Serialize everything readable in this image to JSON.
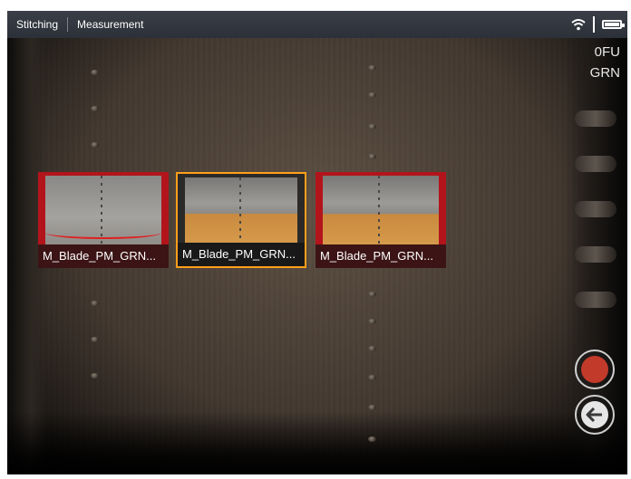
{
  "topbar": {
    "tabs": [
      "Stitching",
      "Measurement"
    ],
    "status_icons": [
      "wifi-icon",
      "battery-icon"
    ]
  },
  "overlay": {
    "line1": "0FU",
    "line2": "GRN"
  },
  "thumbnails": [
    {
      "label": "M_Blade_PM_GRN...",
      "selected": false
    },
    {
      "label": "M_Blade_PM_GRN...",
      "selected": true
    },
    {
      "label": "M_Blade_PM_GRN...",
      "selected": false
    }
  ],
  "controls": {
    "record": "record-icon",
    "back": "back-arrow-icon"
  },
  "colors": {
    "selection_border": "#ff9f1a",
    "thumb_frame": "#b3141b",
    "record": "#c23a2a"
  }
}
